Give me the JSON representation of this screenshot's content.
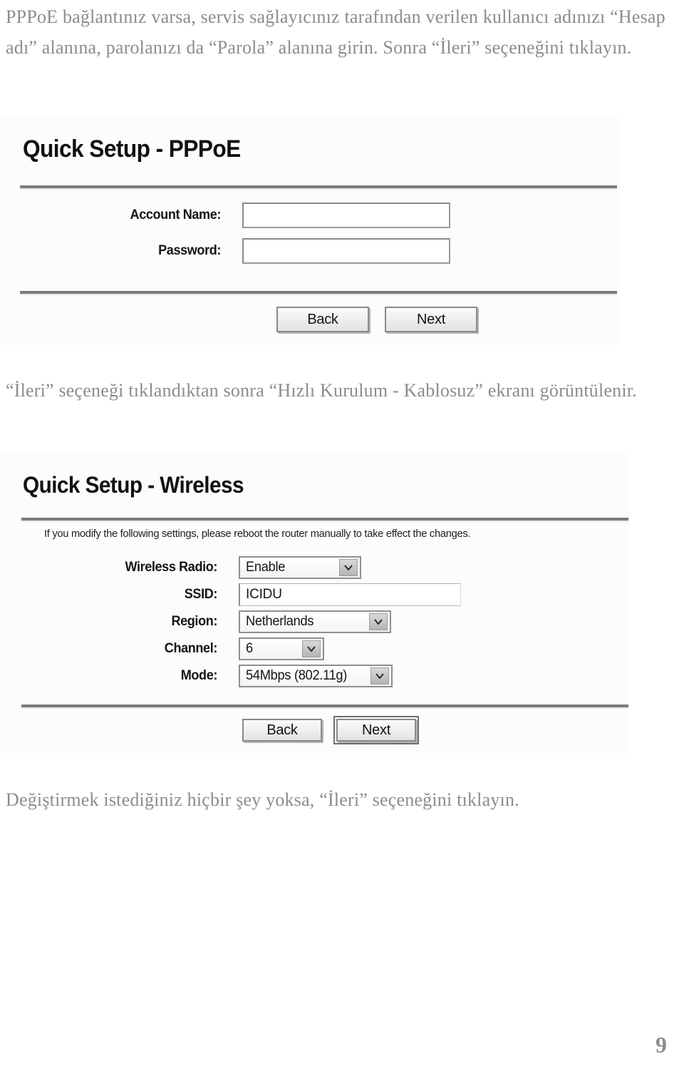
{
  "page": {
    "number": "9",
    "intro_paragraph": "PPPoE bağlantınız varsa, servis sağlayıcınız tarafından verilen kullanıcı adınızı “Hesap adı” alanına, parolanızı da “Parola” alanına girin. Sonra “İleri” seçeneğini tıklayın.",
    "mid_paragraph": "“İleri” seçeneği tıklandıktan sonra “Hızlı Kurulum - Kablosuz” ekranı görüntülenir.",
    "closing_paragraph": "Değiştirmek istediğiniz hiçbir şey yoksa, “İleri” seçeneğini tıklayın."
  },
  "pppoe_screen": {
    "title": "Quick Setup - PPPoE",
    "fields": [
      {
        "label": "Account Name:",
        "value": "",
        "type": "text"
      },
      {
        "label": "Password:",
        "value": "",
        "type": "text"
      }
    ],
    "buttons": [
      {
        "label": "Back",
        "focused": false
      },
      {
        "label": "Next",
        "focused": false
      }
    ]
  },
  "wireless_screen": {
    "title": "Quick Setup - Wireless",
    "note": "If you modify the following settings, please reboot the router manually to take effect the changes.",
    "fields": [
      {
        "label": "Wireless Radio:",
        "value": "Enable",
        "type": "select"
      },
      {
        "label": "SSID:",
        "value": "ICIDU",
        "type": "text"
      },
      {
        "label": "Region:",
        "value": "Netherlands",
        "type": "select"
      },
      {
        "label": "Channel:",
        "value": "6",
        "type": "select"
      },
      {
        "label": "Mode:",
        "value": "54Mbps (802.11g)",
        "type": "select"
      }
    ],
    "buttons": [
      {
        "label": "Back",
        "focused": false
      },
      {
        "label": "Next",
        "focused": true
      }
    ]
  },
  "colors": {
    "scan_text": "#8c8c8c",
    "ui_text": "#151515",
    "rule": "#7c7c7c",
    "panel_bg": "#fcfcfc"
  }
}
